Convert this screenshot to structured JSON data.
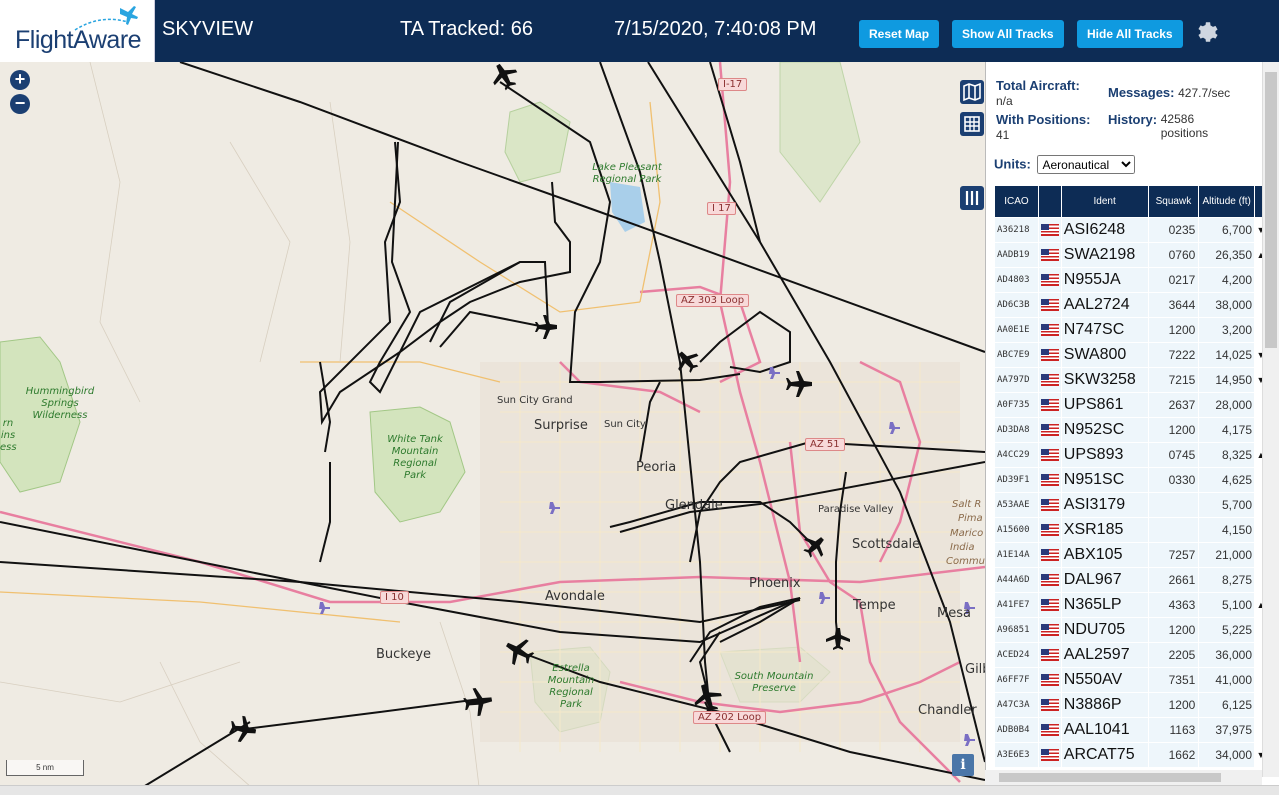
{
  "header": {
    "logo_text": "FlightAware",
    "site_name": "SKYVIEW",
    "ta_tracked": "TA Tracked: 66",
    "datetime": "7/15/2020, 7:40:08 PM",
    "reset_map": "Reset Map",
    "show_all_tracks": "Show All Tracks",
    "hide_all_tracks": "Hide All Tracks",
    "settings_icon": "gear-icon"
  },
  "map": {
    "zoom_in": "+",
    "zoom_out": "−",
    "scale_label": "5 nm",
    "info_label": "i",
    "cities": [
      "Sun City Grand",
      "Surprise",
      "Sun City",
      "Peoria",
      "Glendale",
      "Paradise Valley",
      "Scottsdale",
      "Phoenix",
      "Tempe",
      "Mesa",
      "Avondale",
      "Buckeye",
      "Chandler",
      "Gilb",
      "Salt R",
      "Pima",
      "Marico",
      "India",
      "Commu"
    ],
    "parks": [
      "Lake Pleasant Regional Park",
      "Hummingbird Springs Wilderness",
      "White Tank Mountain Regional Park",
      "Estrella Mountain Regional Park",
      "South Mountain Preserve",
      "rn ins ess"
    ],
    "highways": [
      "I-17",
      "I 17",
      "AZ 303 Loop",
      "AZ 51",
      "I 10",
      "AZ 202 Loop"
    ],
    "colors": {
      "land": "#efebe3",
      "track": "#111111",
      "highway": "#e07a9a",
      "park": "#c8e0b0"
    }
  },
  "sidebar": {
    "total_aircraft_label": "Total Aircraft:",
    "total_aircraft_value": "n/a",
    "with_positions_label": "With Positions:",
    "with_positions_value": "41",
    "messages_label": "Messages:",
    "messages_value": "427.7/sec",
    "history_label": "History:",
    "history_value": "42586 positions",
    "units_label": "Units:",
    "units_selected": "Aeronautical",
    "columns": [
      "ICAO",
      "",
      "Ident",
      "Squawk",
      "Altitude (ft)"
    ],
    "rows": [
      {
        "icao": "A36218",
        "ident": "ASI6248",
        "squawk": "0235",
        "alt": "6,700",
        "trend": "▼"
      },
      {
        "icao": "AADB19",
        "ident": "SWA2198",
        "squawk": "0760",
        "alt": "26,350",
        "trend": "▲"
      },
      {
        "icao": "AD4803",
        "ident": "N955JA",
        "squawk": "0217",
        "alt": "4,200",
        "trend": ""
      },
      {
        "icao": "AD6C3B",
        "ident": "AAL2724",
        "squawk": "3644",
        "alt": "38,000",
        "trend": ""
      },
      {
        "icao": "AA0E1E",
        "ident": "N747SC",
        "squawk": "1200",
        "alt": "3,200",
        "trend": ""
      },
      {
        "icao": "ABC7E9",
        "ident": "SWA800",
        "squawk": "7222",
        "alt": "14,025",
        "trend": "▼"
      },
      {
        "icao": "AA797D",
        "ident": "SKW3258",
        "squawk": "7215",
        "alt": "14,950",
        "trend": "▼"
      },
      {
        "icao": "A0F735",
        "ident": "UPS861",
        "squawk": "2637",
        "alt": "28,000",
        "trend": ""
      },
      {
        "icao": "AD3DA8",
        "ident": "N952SC",
        "squawk": "1200",
        "alt": "4,175",
        "trend": ""
      },
      {
        "icao": "A4CC29",
        "ident": "UPS893",
        "squawk": "0745",
        "alt": "8,325",
        "trend": "▲"
      },
      {
        "icao": "AD39F1",
        "ident": "N951SC",
        "squawk": "0330",
        "alt": "4,625",
        "trend": ""
      },
      {
        "icao": "A53AAE",
        "ident": "ASI3179",
        "squawk": "",
        "alt": "5,700",
        "trend": ""
      },
      {
        "icao": "A15600",
        "ident": "XSR185",
        "squawk": "",
        "alt": "4,150",
        "trend": ""
      },
      {
        "icao": "A1E14A",
        "ident": "ABX105",
        "squawk": "7257",
        "alt": "21,000",
        "trend": ""
      },
      {
        "icao": "A44A6D",
        "ident": "DAL967",
        "squawk": "2661",
        "alt": "8,275",
        "trend": ""
      },
      {
        "icao": "A41FE7",
        "ident": "N365LP",
        "squawk": "4363",
        "alt": "5,100",
        "trend": "▲"
      },
      {
        "icao": "A96851",
        "ident": "NDU705",
        "squawk": "1200",
        "alt": "5,225",
        "trend": ""
      },
      {
        "icao": "ACED24",
        "ident": "AAL2597",
        "squawk": "2205",
        "alt": "36,000",
        "trend": ""
      },
      {
        "icao": "A6FF7F",
        "ident": "N550AV",
        "squawk": "7351",
        "alt": "41,000",
        "trend": ""
      },
      {
        "icao": "A47C3A",
        "ident": "N3886P",
        "squawk": "1200",
        "alt": "6,125",
        "trend": ""
      },
      {
        "icao": "ADB0B4",
        "ident": "AAL1041",
        "squawk": "1163",
        "alt": "37,975",
        "trend": ""
      },
      {
        "icao": "A3E6E3",
        "ident": "ARCAT75",
        "squawk": "1662",
        "alt": "34,000",
        "trend": "▼"
      }
    ]
  }
}
